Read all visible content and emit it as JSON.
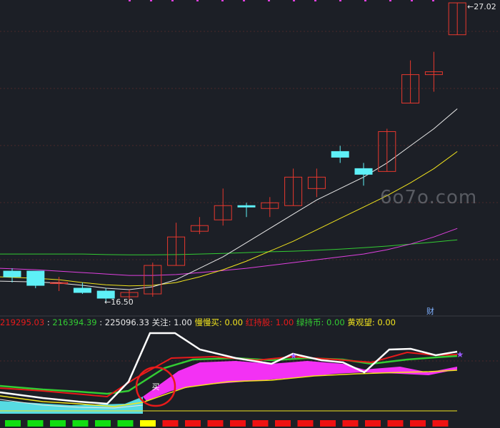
{
  "indicators": {
    "v1": "219295.03",
    "sep1": " : ",
    "v2": "216394.39",
    "sep2": " : ",
    "v3": "225096.33",
    "guanzhu": "关注: 1.00",
    "manman": "慢慢买: 0.00",
    "hongchi": "红持股: 1.00",
    "lvchi": "绿持币: 0.00",
    "huangguan": "黄观望: 0.00"
  },
  "colors": {
    "background": "#1c1f26",
    "up": "#e8382e",
    "down": "#5ef0f7",
    "white_line": "#e8e8e8",
    "yellow_line": "#f2e41d",
    "magenta_line": "#e040e0",
    "green_line": "#33cc33",
    "red_line": "#e81a1a",
    "fill_magenta": "#ff33ff",
    "fill_cyan": "#5ef0f7",
    "grid": "#4a2a2a"
  },
  "watermark": "6o7o.com",
  "cai_label": "财",
  "buy_label": "买",
  "chart_data": {
    "type": "candlestick",
    "high_label": "27.02",
    "low_label": "16.50",
    "candles": [
      {
        "o": 17.6,
        "c": 17.4,
        "h": 17.7,
        "l": 17.2
      },
      {
        "o": 17.6,
        "c": 17.1,
        "h": 17.6,
        "l": 17.0
      },
      {
        "o": 17.2,
        "c": 17.2,
        "h": 17.4,
        "l": 16.9
      },
      {
        "o": 17.0,
        "c": 16.85,
        "h": 17.2,
        "l": 16.8
      },
      {
        "o": 16.9,
        "c": 16.65,
        "h": 17.0,
        "l": 16.5
      },
      {
        "o": 16.7,
        "c": 16.85,
        "h": 16.95,
        "l": 16.6
      },
      {
        "o": 16.8,
        "c": 17.8,
        "h": 17.9,
        "l": 16.7
      },
      {
        "o": 17.8,
        "c": 18.8,
        "h": 19.3,
        "l": 17.8
      },
      {
        "o": 19.0,
        "c": 19.2,
        "h": 19.5,
        "l": 18.9
      },
      {
        "o": 19.4,
        "c": 19.9,
        "h": 20.5,
        "l": 19.2
      },
      {
        "o": 19.9,
        "c": 19.85,
        "h": 20.0,
        "l": 19.5
      },
      {
        "o": 19.8,
        "c": 20.0,
        "h": 20.2,
        "l": 19.5
      },
      {
        "o": 19.9,
        "c": 20.9,
        "h": 21.2,
        "l": 19.9
      },
      {
        "o": 20.5,
        "c": 20.9,
        "h": 21.2,
        "l": 20.2
      },
      {
        "o": 21.8,
        "c": 21.6,
        "h": 22.0,
        "l": 21.4
      },
      {
        "o": 21.2,
        "c": 21.0,
        "h": 21.4,
        "l": 20.6
      },
      {
        "o": 21.1,
        "c": 22.5,
        "h": 22.6,
        "l": 21.1
      },
      {
        "o": 23.5,
        "c": 24.5,
        "h": 25.0,
        "l": 23.5
      },
      {
        "o": 24.5,
        "c": 24.6,
        "h": 25.3,
        "l": 23.9
      },
      {
        "o": 25.9,
        "c": 27.02,
        "h": 27.02,
        "l": 25.9
      }
    ],
    "ma_white": [
      17.25,
      17.22,
      17.18,
      17.1,
      17.0,
      16.95,
      17.05,
      17.3,
      17.7,
      18.1,
      18.6,
      19.1,
      19.6,
      20.1,
      20.5,
      20.9,
      21.4,
      22.0,
      22.6,
      23.3
    ],
    "ma_yellow": [
      17.4,
      17.35,
      17.3,
      17.2,
      17.12,
      17.08,
      17.1,
      17.2,
      17.4,
      17.65,
      17.95,
      18.3,
      18.65,
      19.05,
      19.45,
      19.85,
      20.25,
      20.7,
      21.2,
      21.8
    ],
    "ma_magenta": [
      17.7,
      17.65,
      17.6,
      17.55,
      17.5,
      17.45,
      17.45,
      17.48,
      17.55,
      17.62,
      17.7,
      17.8,
      17.9,
      18.0,
      18.1,
      18.2,
      18.35,
      18.55,
      18.8,
      19.1
    ],
    "ma_green": [
      18.2,
      18.2,
      18.2,
      18.2,
      18.18,
      18.17,
      18.17,
      18.18,
      18.2,
      18.22,
      18.25,
      18.28,
      18.3,
      18.33,
      18.37,
      18.42,
      18.48,
      18.55,
      18.62,
      18.7
    ],
    "signal_squares": [
      "green",
      "green",
      "green",
      "green",
      "green",
      "green",
      "yellow",
      "red",
      "red",
      "red",
      "red",
      "red",
      "red",
      "red",
      "red",
      "red",
      "red",
      "red",
      "red",
      "red"
    ]
  }
}
